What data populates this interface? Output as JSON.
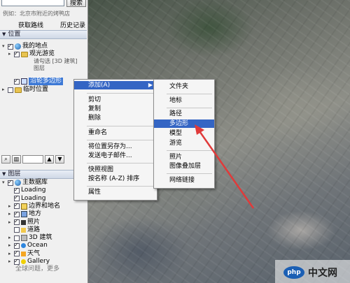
{
  "search": {
    "placeholder": "",
    "button_label": "搜索",
    "hint": "例如：北京市附近的烤鸭店"
  },
  "search_links": {
    "directions": "获取路线",
    "history": "历史记录"
  },
  "places": {
    "header": "位置",
    "my_places": "我的地点",
    "sightseeing": "观光游览",
    "sightseeing_desc": "请勾选 [3D 建筑] 图层",
    "untitled_polygon": "沿轮多边形",
    "temporary_places": "临时位置"
  },
  "layers": {
    "header": "图层",
    "items": [
      {
        "label": "主数据库",
        "checked": true,
        "expander": "▾",
        "icon": "globe-icon"
      },
      {
        "label": "Loading",
        "checked": true,
        "expander": "",
        "icon": ""
      },
      {
        "label": "Loading",
        "checked": true,
        "expander": "",
        "icon": ""
      },
      {
        "label": "边界和地名",
        "checked": true,
        "expander": "▸",
        "icon": "borders-icon"
      },
      {
        "label": "地方",
        "checked": true,
        "expander": "▸",
        "icon": "places-icon"
      },
      {
        "label": "照片",
        "checked": true,
        "expander": "▸",
        "icon": "photos-icon"
      },
      {
        "label": "道路",
        "checked": false,
        "expander": "",
        "icon": "roads-icon"
      },
      {
        "label": "3D 建筑",
        "checked": false,
        "expander": "▸",
        "icon": "buildings-icon"
      },
      {
        "label": "Ocean",
        "checked": true,
        "expander": "▸",
        "icon": "ocean-icon"
      },
      {
        "label": "天气",
        "checked": true,
        "expander": "▸",
        "icon": "weather-icon"
      },
      {
        "label": "Gallery",
        "checked": true,
        "expander": "▸",
        "icon": "gallery-icon"
      }
    ],
    "partial_last_row": "全球问题，更多"
  },
  "context_menu": {
    "add": "添加(A)",
    "cut": "剪切",
    "copy": "复制",
    "delete": "删除",
    "rename": "重命名",
    "save_place_as": "将位置另存为...",
    "email": "发送电子邮件...",
    "snapshot": "快照视图",
    "sort": "按名称 (A-Z) 排序",
    "properties": "属性"
  },
  "add_submenu": {
    "folder": "文件夹",
    "placemark": "地标",
    "path": "路径",
    "polygon": "多边形",
    "model": "模型",
    "tour": "游览",
    "photo": "照片",
    "image_overlay": "图像叠加层",
    "network_link": "网络链接"
  },
  "watermark": {
    "logo": "php",
    "text": "中文网"
  },
  "colors": {
    "highlight": "#3465c4",
    "arrow": "#e03a3a",
    "folder": "#e8c350"
  }
}
